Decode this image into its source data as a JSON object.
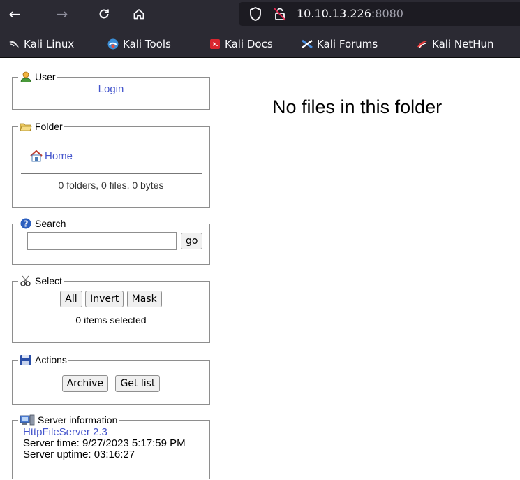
{
  "browser": {
    "url_host": "10.10.13.226",
    "url_port": ":8080",
    "bookmarks": [
      {
        "label": "Kali Linux",
        "icon": "kali-dragon-icon"
      },
      {
        "label": "Kali Tools",
        "icon": "kali-tools-icon"
      },
      {
        "label": "Kali Docs",
        "icon": "kali-docs-icon"
      },
      {
        "label": "Kali Forums",
        "icon": "kali-forums-icon"
      },
      {
        "label": "Kali NetHun",
        "icon": "kali-nethunter-icon"
      }
    ]
  },
  "panels": {
    "user": {
      "legend": "User",
      "login_link": "Login"
    },
    "folder": {
      "legend": "Folder",
      "home_link": "Home",
      "summary": "0 folders, 0 files, 0 bytes"
    },
    "search": {
      "legend": "Search",
      "input_value": "",
      "go_label": "go"
    },
    "select": {
      "legend": "Select",
      "all_label": "All",
      "invert_label": "Invert",
      "mask_label": "Mask",
      "selected_text": "0 items selected"
    },
    "actions": {
      "legend": "Actions",
      "archive_label": "Archive",
      "getlist_label": "Get list"
    },
    "server": {
      "legend": "Server information",
      "software_link": "HttpFileServer 2.3",
      "server_time": "Server time: 9/27/2023 5:17:59 PM",
      "server_uptime": "Server uptime: 03:16:27"
    }
  },
  "main": {
    "message": "No files in this folder"
  },
  "colors": {
    "link": "#4455cc",
    "chrome_bg": "#2b2a33",
    "urlbar_bg": "#1c1b22"
  }
}
